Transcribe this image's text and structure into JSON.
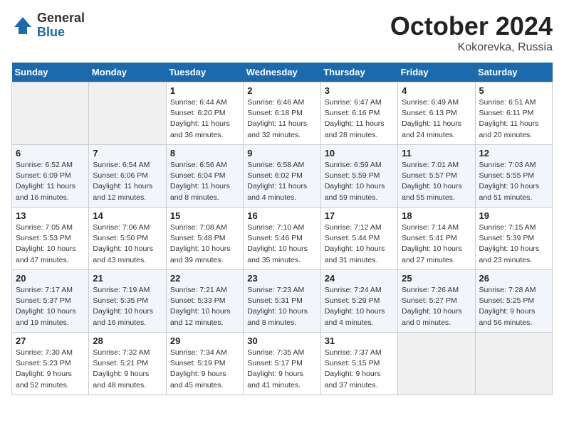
{
  "logo": {
    "general": "General",
    "blue": "Blue"
  },
  "title": "October 2024",
  "location": "Kokorevka, Russia",
  "days_of_week": [
    "Sunday",
    "Monday",
    "Tuesday",
    "Wednesday",
    "Thursday",
    "Friday",
    "Saturday"
  ],
  "weeks": [
    [
      {
        "day": "",
        "sunrise": "",
        "sunset": "",
        "daylight": ""
      },
      {
        "day": "",
        "sunrise": "",
        "sunset": "",
        "daylight": ""
      },
      {
        "day": "1",
        "sunrise": "Sunrise: 6:44 AM",
        "sunset": "Sunset: 6:20 PM",
        "daylight": "Daylight: 11 hours and 36 minutes."
      },
      {
        "day": "2",
        "sunrise": "Sunrise: 6:46 AM",
        "sunset": "Sunset: 6:18 PM",
        "daylight": "Daylight: 11 hours and 32 minutes."
      },
      {
        "day": "3",
        "sunrise": "Sunrise: 6:47 AM",
        "sunset": "Sunset: 6:16 PM",
        "daylight": "Daylight: 11 hours and 28 minutes."
      },
      {
        "day": "4",
        "sunrise": "Sunrise: 6:49 AM",
        "sunset": "Sunset: 6:13 PM",
        "daylight": "Daylight: 11 hours and 24 minutes."
      },
      {
        "day": "5",
        "sunrise": "Sunrise: 6:51 AM",
        "sunset": "Sunset: 6:11 PM",
        "daylight": "Daylight: 11 hours and 20 minutes."
      }
    ],
    [
      {
        "day": "6",
        "sunrise": "Sunrise: 6:52 AM",
        "sunset": "Sunset: 6:09 PM",
        "daylight": "Daylight: 11 hours and 16 minutes."
      },
      {
        "day": "7",
        "sunrise": "Sunrise: 6:54 AM",
        "sunset": "Sunset: 6:06 PM",
        "daylight": "Daylight: 11 hours and 12 minutes."
      },
      {
        "day": "8",
        "sunrise": "Sunrise: 6:56 AM",
        "sunset": "Sunset: 6:04 PM",
        "daylight": "Daylight: 11 hours and 8 minutes."
      },
      {
        "day": "9",
        "sunrise": "Sunrise: 6:58 AM",
        "sunset": "Sunset: 6:02 PM",
        "daylight": "Daylight: 11 hours and 4 minutes."
      },
      {
        "day": "10",
        "sunrise": "Sunrise: 6:59 AM",
        "sunset": "Sunset: 5:59 PM",
        "daylight": "Daylight: 10 hours and 59 minutes."
      },
      {
        "day": "11",
        "sunrise": "Sunrise: 7:01 AM",
        "sunset": "Sunset: 5:57 PM",
        "daylight": "Daylight: 10 hours and 55 minutes."
      },
      {
        "day": "12",
        "sunrise": "Sunrise: 7:03 AM",
        "sunset": "Sunset: 5:55 PM",
        "daylight": "Daylight: 10 hours and 51 minutes."
      }
    ],
    [
      {
        "day": "13",
        "sunrise": "Sunrise: 7:05 AM",
        "sunset": "Sunset: 5:53 PM",
        "daylight": "Daylight: 10 hours and 47 minutes."
      },
      {
        "day": "14",
        "sunrise": "Sunrise: 7:06 AM",
        "sunset": "Sunset: 5:50 PM",
        "daylight": "Daylight: 10 hours and 43 minutes."
      },
      {
        "day": "15",
        "sunrise": "Sunrise: 7:08 AM",
        "sunset": "Sunset: 5:48 PM",
        "daylight": "Daylight: 10 hours and 39 minutes."
      },
      {
        "day": "16",
        "sunrise": "Sunrise: 7:10 AM",
        "sunset": "Sunset: 5:46 PM",
        "daylight": "Daylight: 10 hours and 35 minutes."
      },
      {
        "day": "17",
        "sunrise": "Sunrise: 7:12 AM",
        "sunset": "Sunset: 5:44 PM",
        "daylight": "Daylight: 10 hours and 31 minutes."
      },
      {
        "day": "18",
        "sunrise": "Sunrise: 7:14 AM",
        "sunset": "Sunset: 5:41 PM",
        "daylight": "Daylight: 10 hours and 27 minutes."
      },
      {
        "day": "19",
        "sunrise": "Sunrise: 7:15 AM",
        "sunset": "Sunset: 5:39 PM",
        "daylight": "Daylight: 10 hours and 23 minutes."
      }
    ],
    [
      {
        "day": "20",
        "sunrise": "Sunrise: 7:17 AM",
        "sunset": "Sunset: 5:37 PM",
        "daylight": "Daylight: 10 hours and 19 minutes."
      },
      {
        "day": "21",
        "sunrise": "Sunrise: 7:19 AM",
        "sunset": "Sunset: 5:35 PM",
        "daylight": "Daylight: 10 hours and 16 minutes."
      },
      {
        "day": "22",
        "sunrise": "Sunrise: 7:21 AM",
        "sunset": "Sunset: 5:33 PM",
        "daylight": "Daylight: 10 hours and 12 minutes."
      },
      {
        "day": "23",
        "sunrise": "Sunrise: 7:23 AM",
        "sunset": "Sunset: 5:31 PM",
        "daylight": "Daylight: 10 hours and 8 minutes."
      },
      {
        "day": "24",
        "sunrise": "Sunrise: 7:24 AM",
        "sunset": "Sunset: 5:29 PM",
        "daylight": "Daylight: 10 hours and 4 minutes."
      },
      {
        "day": "25",
        "sunrise": "Sunrise: 7:26 AM",
        "sunset": "Sunset: 5:27 PM",
        "daylight": "Daylight: 10 hours and 0 minutes."
      },
      {
        "day": "26",
        "sunrise": "Sunrise: 7:28 AM",
        "sunset": "Sunset: 5:25 PM",
        "daylight": "Daylight: 9 hours and 56 minutes."
      }
    ],
    [
      {
        "day": "27",
        "sunrise": "Sunrise: 7:30 AM",
        "sunset": "Sunset: 5:23 PM",
        "daylight": "Daylight: 9 hours and 52 minutes."
      },
      {
        "day": "28",
        "sunrise": "Sunrise: 7:32 AM",
        "sunset": "Sunset: 5:21 PM",
        "daylight": "Daylight: 9 hours and 48 minutes."
      },
      {
        "day": "29",
        "sunrise": "Sunrise: 7:34 AM",
        "sunset": "Sunset: 5:19 PM",
        "daylight": "Daylight: 9 hours and 45 minutes."
      },
      {
        "day": "30",
        "sunrise": "Sunrise: 7:35 AM",
        "sunset": "Sunset: 5:17 PM",
        "daylight": "Daylight: 9 hours and 41 minutes."
      },
      {
        "day": "31",
        "sunrise": "Sunrise: 7:37 AM",
        "sunset": "Sunset: 5:15 PM",
        "daylight": "Daylight: 9 hours and 37 minutes."
      },
      {
        "day": "",
        "sunrise": "",
        "sunset": "",
        "daylight": ""
      },
      {
        "day": "",
        "sunrise": "",
        "sunset": "",
        "daylight": ""
      }
    ]
  ]
}
